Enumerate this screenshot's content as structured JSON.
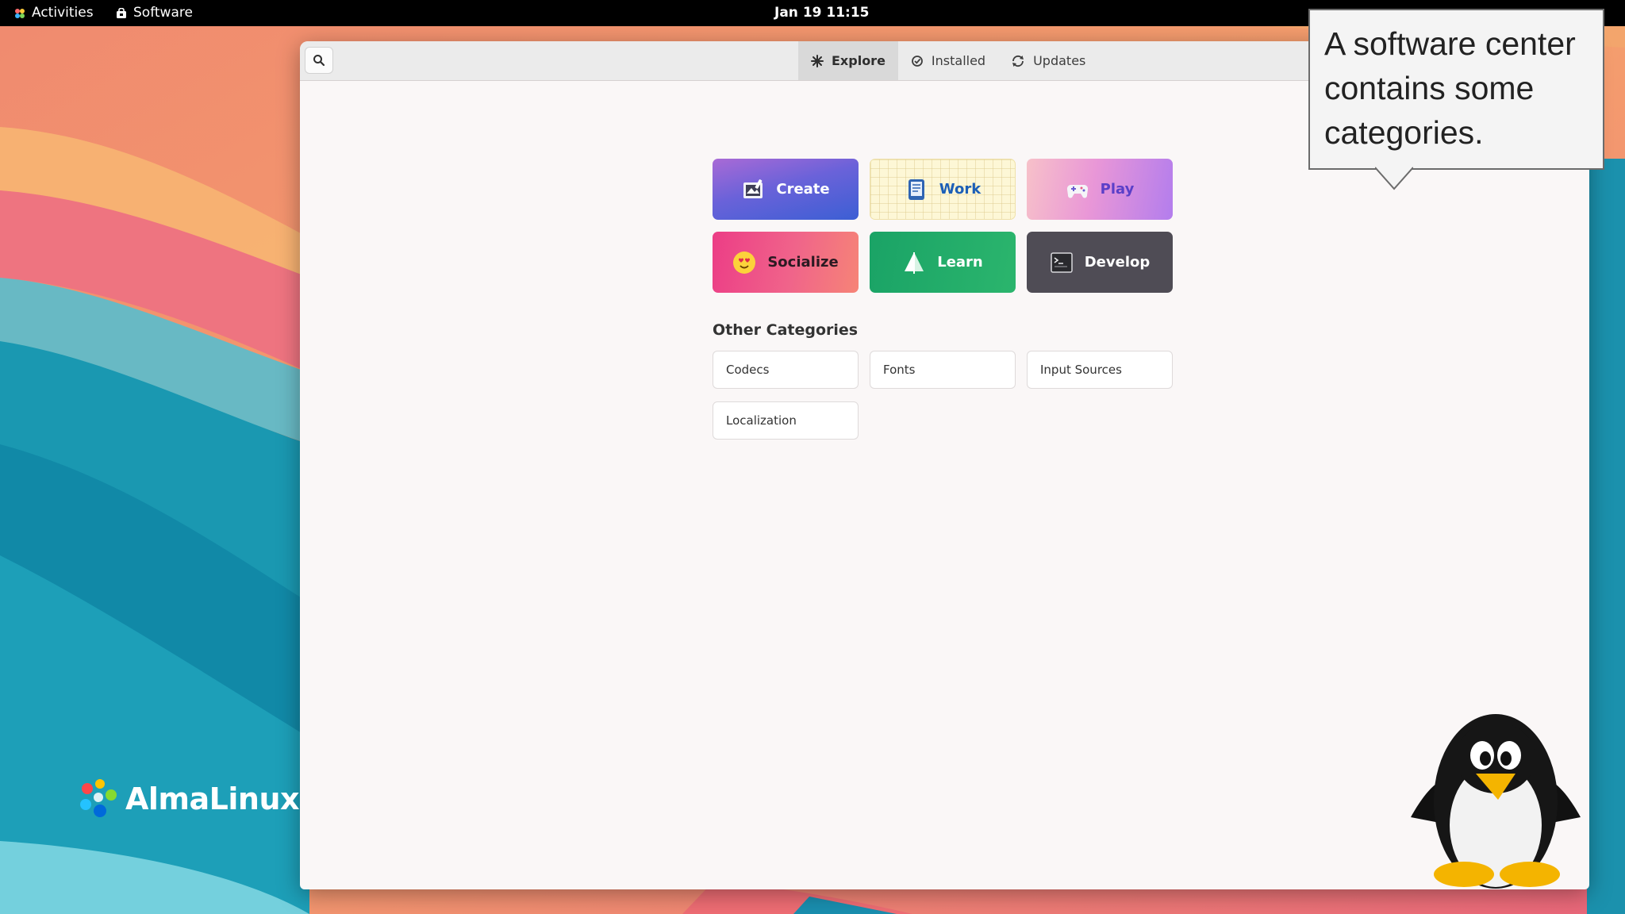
{
  "topbar": {
    "activities_label": "Activities",
    "app_label": "Software",
    "clock": "Jan 19  11:15"
  },
  "headerbar": {
    "tabs": [
      {
        "label": "Explore",
        "icon": "explore-icon",
        "active": true
      },
      {
        "label": "Installed",
        "icon": "installed-check-icon",
        "active": false
      },
      {
        "label": "Updates",
        "icon": "updates-refresh-icon",
        "active": false
      }
    ]
  },
  "categories": {
    "main": [
      {
        "label": "Create",
        "icon": "create-icon"
      },
      {
        "label": "Work",
        "icon": "work-icon"
      },
      {
        "label": "Play",
        "icon": "gamepad-icon"
      },
      {
        "label": "Socialize",
        "icon": "emoji-icon"
      },
      {
        "label": "Learn",
        "icon": "sail-icon"
      },
      {
        "label": "Develop",
        "icon": "terminal-icon"
      }
    ],
    "other_title": "Other Categories",
    "other": [
      {
        "label": "Codecs"
      },
      {
        "label": "Fonts"
      },
      {
        "label": "Input Sources"
      },
      {
        "label": "Localization"
      }
    ]
  },
  "branding": {
    "logo_text": "AlmaLinux"
  },
  "annotation": {
    "callout_text": "A software center contains some categories."
  },
  "colors": {
    "topbar": "#000000",
    "window_bg": "#faf7f7",
    "headerbar": "#ebebeb",
    "create_tile": "#5b62d8",
    "socialize_tile": "#ee4f86",
    "learn_tile": "#22ac69",
    "develop_tile": "#4f4c55"
  }
}
